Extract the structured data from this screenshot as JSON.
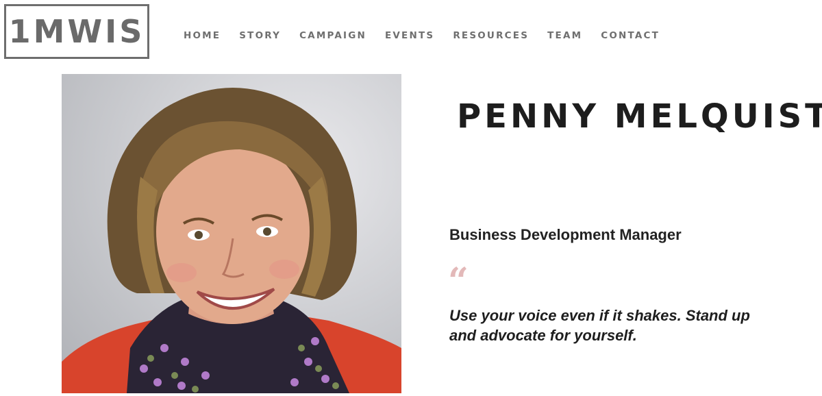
{
  "header": {
    "logo_text": "1MWIS",
    "nav": [
      {
        "label": "HOME"
      },
      {
        "label": "STORY"
      },
      {
        "label": "CAMPAIGN"
      },
      {
        "label": "EVENTS"
      },
      {
        "label": "RESOURCES"
      },
      {
        "label": "TEAM"
      },
      {
        "label": "CONTACT"
      }
    ]
  },
  "profile": {
    "name": "PENNY MELQUIST",
    "role": "Business Development Manager",
    "quote_mark": "“",
    "quote": "Use your voice even if it shakes. Stand up and advocate for yourself.",
    "photo_icon": "portrait-photo"
  },
  "colors": {
    "nav_text": "#6f6f6f",
    "logo_border": "#6e6e6e",
    "quote_mark": "#e3b9b9",
    "photo_background": "#cfd0d4",
    "jacket": "#d8442c"
  }
}
